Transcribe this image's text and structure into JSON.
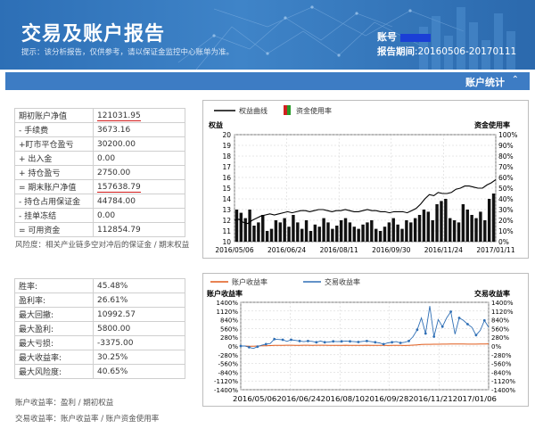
{
  "header": {
    "title": "交易及账户报告",
    "hint": "提示：该分析报告，仅供参考，请以保证金监控中心账单为准。",
    "account_label": "账号",
    "period_label": "报告期间",
    "period_value": ":20160506-20170111"
  },
  "section": {
    "label": "账户统计",
    "toggle_icon": "double-chevron-up-icon"
  },
  "account_table": {
    "rows": [
      {
        "label": "期初账户净值",
        "value": "121031.95"
      },
      {
        "label": "- 手续费",
        "value": "3673.16"
      },
      {
        "label": "+盯市平仓盈亏",
        "value": "30200.00"
      },
      {
        "label": "+ 出入金",
        "value": "0.00"
      },
      {
        "label": "+ 持仓盈亏",
        "value": "2750.00"
      },
      {
        "label": "= 期末账户净值",
        "value": "157638.79"
      },
      {
        "label": "- 持仓占用保证金",
        "value": "44784.00"
      },
      {
        "label": "- 挂单冻结",
        "value": "0.00"
      },
      {
        "label": "= 可用资金",
        "value": "112854.79"
      }
    ],
    "note": "风险度：相关产业链多空对冲后的保证金 / 期末权益"
  },
  "perf_table": {
    "rows": [
      {
        "label": "胜率:",
        "value": "45.48%"
      },
      {
        "label": "盈利率:",
        "value": "26.61%"
      },
      {
        "label": "最大回撤:",
        "value": "10992.57"
      },
      {
        "label": "最大盈利:",
        "value": "5800.00"
      },
      {
        "label": "最大亏损:",
        "value": "-3375.00"
      },
      {
        "label": "最大收益率:",
        "value": "30.25%"
      },
      {
        "label": "最大风险度:",
        "value": "40.65%"
      }
    ],
    "note1": "账户收益率：盈利 / 期初权益",
    "note2": "交易收益率：账户收益率 / 账户资金使用率"
  },
  "colors": {
    "banner": "#3f84c8",
    "secbar": "#3d7cc4",
    "underline": "#d21a1a",
    "equity_line": "#000000",
    "usage_bar": "#000000",
    "account_return": "#e05a1a",
    "trade_return": "#2f6fb5"
  },
  "chart_data": [
    {
      "type": "line",
      "legend": [
        "权益曲线",
        "资金使用率"
      ],
      "ylabel_left": "权益",
      "ylabel_right": "资金使用率",
      "y_left_ticks": [
        "20",
        "19",
        "18",
        "17",
        "16",
        "15",
        "14",
        "13",
        "12",
        "11",
        "10"
      ],
      "y_right_ticks": [
        "100%",
        "90%",
        "80%",
        "70%",
        "60%",
        "50%",
        "40%",
        "30%",
        "20%",
        "10%",
        "0%"
      ],
      "ylim_left": [
        10,
        20
      ],
      "ylim_right": [
        0,
        100
      ],
      "x_ticks": [
        "2016/05/06",
        "2016/06/24",
        "2016/08/11",
        "2016/09/30",
        "2016/11/24",
        "2017/01/11"
      ],
      "equity": [
        12.0,
        12.1,
        11.8,
        11.7,
        12.0,
        12.2,
        12.4,
        12.5,
        12.6,
        12.5,
        12.6,
        12.7,
        12.8,
        12.7,
        12.8,
        12.9,
        12.9,
        12.8,
        12.9,
        13.0,
        13.0,
        12.9,
        12.8,
        12.9,
        12.9,
        13.0,
        12.9,
        12.8,
        12.8,
        12.9,
        13.0,
        12.9,
        12.9,
        12.8,
        12.8,
        12.7,
        12.8,
        12.8,
        12.8,
        12.7,
        12.9,
        13.1,
        13.5,
        14.0,
        14.4,
        14.3,
        14.6,
        14.5,
        14.5,
        14.6,
        14.9,
        15.0,
        15.2,
        15.2,
        15.1,
        15.0,
        15.0,
        15.3,
        15.5,
        15.8
      ],
      "usage": [
        30,
        27,
        22,
        30,
        15,
        18,
        25,
        10,
        12,
        20,
        18,
        22,
        14,
        25,
        18,
        12,
        20,
        10,
        16,
        14,
        22,
        18,
        12,
        15,
        20,
        22,
        18,
        14,
        12,
        16,
        18,
        20,
        12,
        10,
        14,
        18,
        22,
        16,
        12,
        20,
        18,
        22,
        25,
        30,
        28,
        20,
        35,
        38,
        40,
        22,
        20,
        18,
        35,
        30,
        25,
        22,
        28,
        20,
        40,
        45
      ]
    },
    {
      "type": "line",
      "legend": [
        "账户收益率",
        "交易收益率"
      ],
      "ylabel_left": "账户收益率",
      "ylabel_right": "交易收益率",
      "y_left_ticks": [
        "1400%",
        "1120%",
        "840%",
        "560%",
        "280%",
        "0%",
        "-280%",
        "-560%",
        "-840%",
        "-1120%",
        "-1400%"
      ],
      "y_right_ticks": [
        "1400%",
        "1120%",
        "840%",
        "560%",
        "280%",
        "0%",
        "-280%",
        "-560%",
        "-840%",
        "-1120%",
        "-1400%"
      ],
      "ylim": [
        -1400,
        1400
      ],
      "x_ticks": [
        "2016/05/06",
        "2016/06/24",
        "2016/08/10",
        "2016/09/28",
        "2016/11/21",
        "2017/01/06"
      ],
      "x_tick_line": "2016/05/062016/06/242016/08/102016/09/282016/11/212017/01/06",
      "account_return": [
        0,
        0,
        -5,
        -10,
        0,
        5,
        10,
        15,
        20,
        20,
        22,
        25,
        25,
        20,
        22,
        25,
        25,
        22,
        25,
        25,
        25,
        22,
        20,
        22,
        22,
        25,
        22,
        20,
        20,
        22,
        25,
        22,
        22,
        20,
        20,
        18,
        20,
        20,
        20,
        18,
        22,
        28,
        38,
        50,
        55,
        55,
        58,
        58,
        60,
        60,
        62,
        62,
        62,
        62,
        60,
        60,
        60,
        62,
        65,
        68
      ],
      "trade_return": [
        0,
        0,
        -40,
        -80,
        -20,
        30,
        60,
        80,
        220,
        210,
        200,
        150,
        200,
        180,
        160,
        140,
        160,
        150,
        120,
        160,
        120,
        130,
        150,
        140,
        150,
        160,
        150,
        140,
        130,
        150,
        160,
        140,
        120,
        100,
        60,
        100,
        120,
        140,
        100,
        120,
        160,
        300,
        520,
        900,
        400,
        1280,
        300,
        850,
        620,
        900,
        1100,
        380,
        900,
        820,
        700,
        600,
        350,
        500,
        820,
        600
      ]
    }
  ]
}
